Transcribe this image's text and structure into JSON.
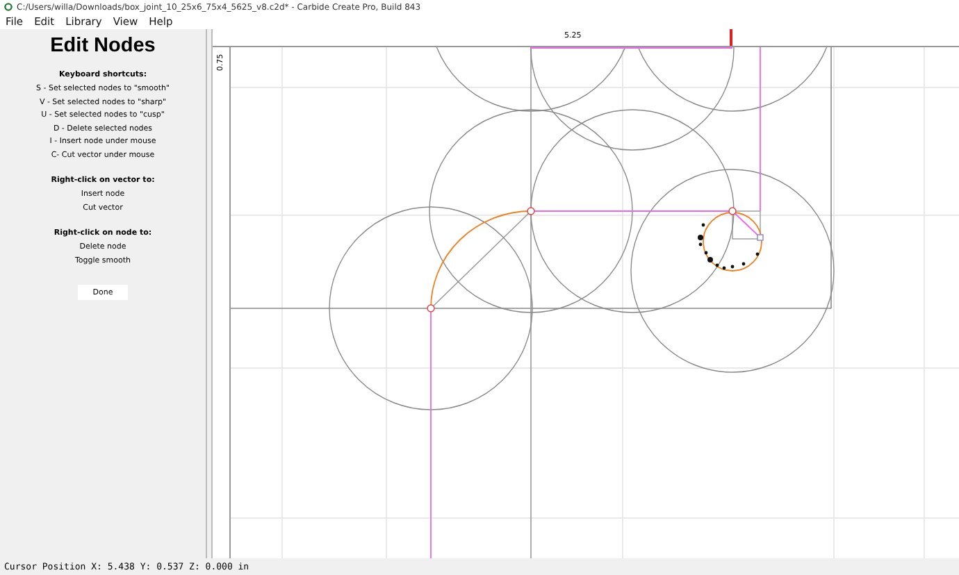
{
  "window": {
    "title": "C:/Users/willa/Downloads/box_joint_10_25x6_75x4_5625_v8.c2d* - Carbide Create Pro, Build 843"
  },
  "menu": [
    {
      "label": "File"
    },
    {
      "label": "Edit"
    },
    {
      "label": "Library"
    },
    {
      "label": "View"
    },
    {
      "label": "Help"
    }
  ],
  "panel": {
    "title": "Edit Nodes",
    "sections": [
      {
        "heading": "Keyboard shortcuts:",
        "lines": [
          "S - Set selected nodes to \"smooth\"",
          "V - Set selected nodes to \"sharp\"",
          "U - Set selected nodes to \"cusp\"",
          "D - Delete selected nodes",
          "I - Insert node under mouse",
          "C- Cut vector under mouse"
        ]
      },
      {
        "heading": "Right-click on vector to:",
        "lines": [
          "Insert node",
          "Cut vector"
        ]
      },
      {
        "heading": "Right-click on node to:",
        "lines": [
          "Delete node",
          "Toggle smooth"
        ]
      }
    ],
    "button": "Done"
  },
  "rulers": {
    "top_label": "5.25",
    "left_label": "0.75"
  },
  "status_bar": "Cursor Position X: 5.438 Y: 0.537 Z: 0.000 in"
}
